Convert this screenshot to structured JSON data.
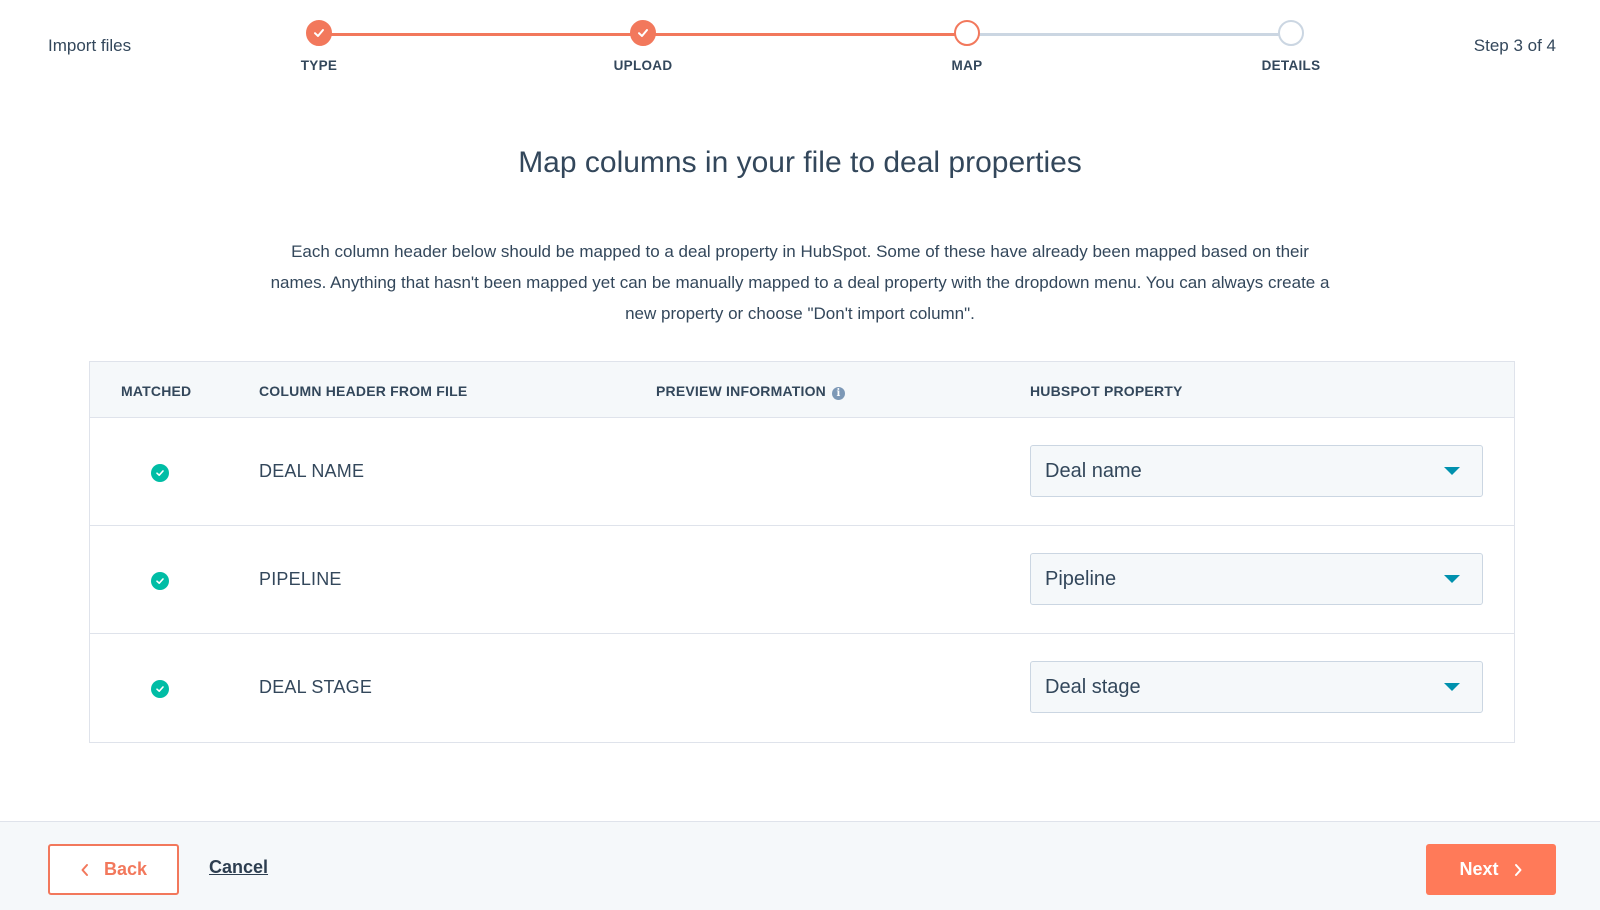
{
  "header": {
    "title": "Import files",
    "step_count": "Step 3 of 4",
    "steps": [
      {
        "label": "TYPE",
        "state": "complete"
      },
      {
        "label": "UPLOAD",
        "state": "complete"
      },
      {
        "label": "MAP",
        "state": "current"
      },
      {
        "label": "DETAILS",
        "state": "pending"
      }
    ]
  },
  "main": {
    "title": "Map columns in your file to deal properties",
    "description": "Each column header below should be mapped to a deal property in HubSpot. Some of these have already been mapped based on their names. Anything that hasn't been mapped yet can be manually mapped to a deal property with the dropdown menu. You can always create a new property or choose \"Don't import column\"."
  },
  "table": {
    "headers": {
      "matched": "MATCHED",
      "column_header": "COLUMN HEADER FROM FILE",
      "preview": "PREVIEW INFORMATION",
      "property": "HUBSPOT PROPERTY"
    },
    "rows": [
      {
        "matched": true,
        "column": "DEAL NAME",
        "property": "Deal name"
      },
      {
        "matched": true,
        "column": "PIPELINE",
        "property": "Pipeline"
      },
      {
        "matched": true,
        "column": "DEAL STAGE",
        "property": "Deal stage"
      }
    ]
  },
  "footer": {
    "back_label": "Back",
    "cancel_label": "Cancel",
    "next_label": "Next"
  },
  "colors": {
    "accent": "#ff7a59",
    "step_active": "#f2785c",
    "matched": "#00bda5",
    "caret": "#0091ae",
    "text": "#33475b"
  },
  "icons": {
    "step_complete": "checkmark-icon",
    "matched": "check-circle-icon",
    "info": "info-icon",
    "select_caret": "caret-down-icon",
    "back": "chevron-left-icon",
    "next": "chevron-right-icon"
  }
}
